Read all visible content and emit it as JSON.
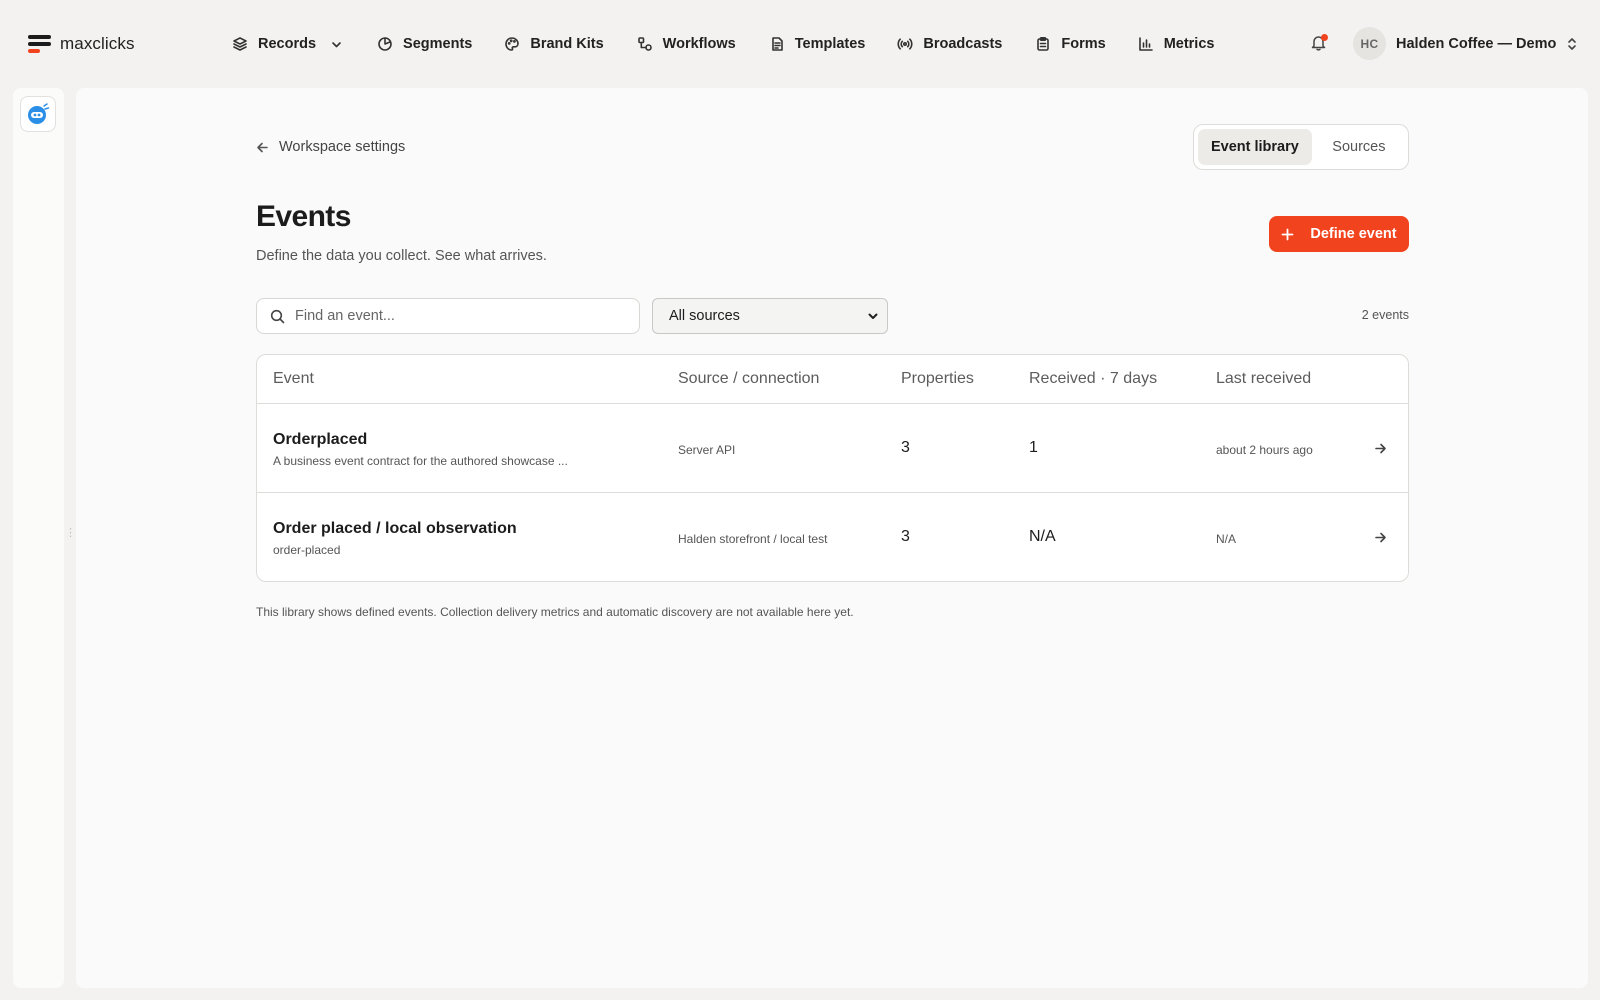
{
  "brand": {
    "name": "maxclicks",
    "accent_color": "#f2431f"
  },
  "nav": {
    "items": [
      {
        "label": "Records",
        "icon": "layers-icon",
        "has_dropdown": true
      },
      {
        "label": "Segments",
        "icon": "pie-chart-icon"
      },
      {
        "label": "Brand Kits",
        "icon": "palette-icon"
      },
      {
        "label": "Workflows",
        "icon": "workflow-icon"
      },
      {
        "label": "Templates",
        "icon": "document-icon"
      },
      {
        "label": "Broadcasts",
        "icon": "broadcast-icon"
      },
      {
        "label": "Forms",
        "icon": "clipboard-icon"
      },
      {
        "label": "Metrics",
        "icon": "bar-chart-icon"
      }
    ]
  },
  "notifications": {
    "icon": "bell-icon",
    "has_unread": true
  },
  "account": {
    "initials": "HC",
    "name": "Halden Coffee — Demo"
  },
  "page": {
    "back_label": "Workspace settings",
    "tabs": [
      {
        "label": "Event library",
        "active": true
      },
      {
        "label": "Sources",
        "active": false
      }
    ],
    "title": "Events",
    "subtitle": "Define the data you collect. See what arrives.",
    "primary_action": "Define event",
    "search_placeholder": "Find an event...",
    "source_filter": "All sources",
    "event_count": "2 events"
  },
  "table": {
    "columns": [
      "Event",
      "Source / connection",
      "Properties",
      "Received · 7 days",
      "Last received"
    ],
    "rows": [
      {
        "name": "Orderplaced",
        "description": "A business event contract for the authored showcase ...",
        "source": "Server API",
        "properties": "3",
        "received_7d": "1",
        "last_received": "about 2 hours ago"
      },
      {
        "name": "Order placed / local observation",
        "description": "order-placed",
        "source": "Halden storefront / local test",
        "properties": "3",
        "received_7d": "N/A",
        "last_received": "N/A"
      }
    ]
  },
  "footnote": "This library shows defined events. Collection delivery metrics and automatic discovery are not available here yet."
}
